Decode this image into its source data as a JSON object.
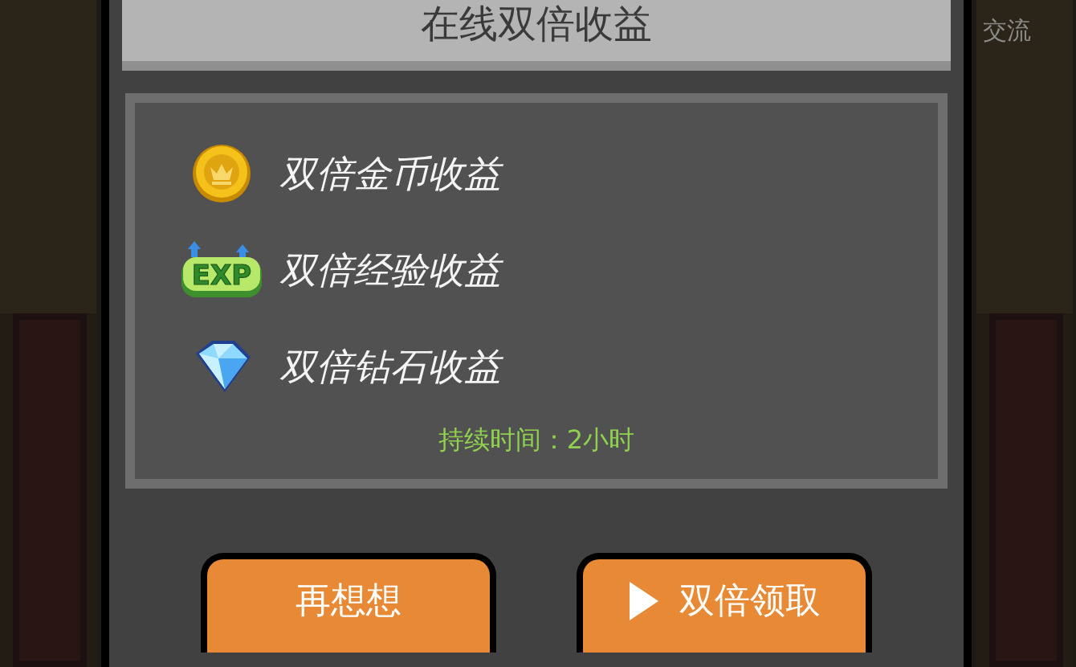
{
  "dialog": {
    "title": "在线双倍收益",
    "rewards": [
      {
        "kind": "coin",
        "label": "双倍金币收益"
      },
      {
        "kind": "exp",
        "badge": "EXP",
        "label": "双倍经验收益"
      },
      {
        "kind": "diamond",
        "label": "双倍钻石收益"
      }
    ],
    "duration": "持续时间：2小时",
    "buttons": [
      {
        "kind": "plain",
        "label": "再想想"
      },
      {
        "kind": "play",
        "label": "双倍领取"
      }
    ]
  },
  "background": {
    "side_label": "交流"
  }
}
